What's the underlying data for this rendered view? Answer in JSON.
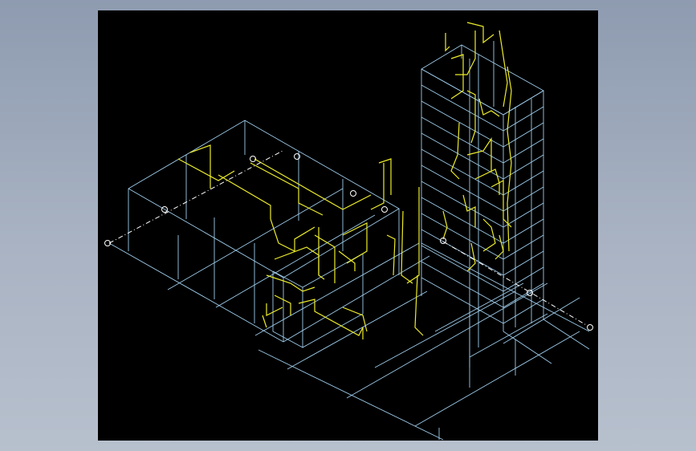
{
  "drawing": {
    "title": "",
    "view": "isometric",
    "background_color": "#000000",
    "frame_color": "#9aa7ba",
    "grid_color": "#9ecbea",
    "pipe_color": "#ecec2a",
    "axis_marker_color": "#ffffff"
  }
}
